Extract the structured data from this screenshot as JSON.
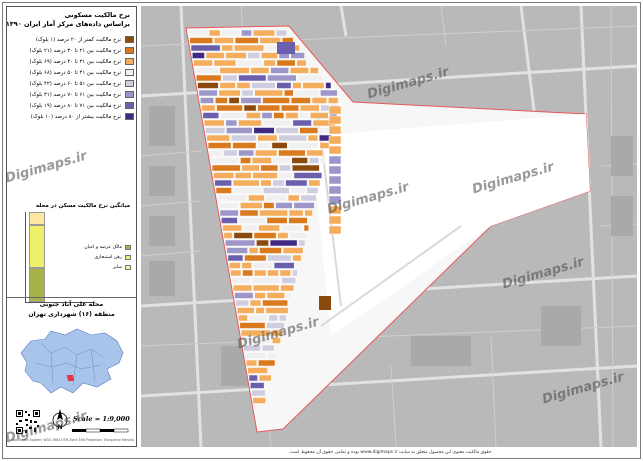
{
  "legend": {
    "title_line1": "نرخ مالکیت مسکونی",
    "title_line2": "براساس داده‌های مرکز آمار ایران ۱۳۹۰",
    "items": [
      {
        "label": "نرخ مالکیت کمتر از ۲۰ درصد (۱ بلوک)",
        "color": "#8a4a0e"
      },
      {
        "label": "نرخ مالکیت بین ۲۱ تا ۳۰ درصد (۲۱ بلوک)",
        "color": "#d97a1f"
      },
      {
        "label": "نرخ مالکیت بین ۳۱ تا ۴۰ درصد (۶۹ بلوک)",
        "color": "#f4ad5c"
      },
      {
        "label": "نرخ مالکیت بین ۴۱ تا ۵۰ درصد (۶۸ بلوک)",
        "color": "#f0f0f0"
      },
      {
        "label": "نرخ مالکیت بین ۵۱ تا ۶۰ درصد (۴۲ بلوک)",
        "color": "#cfcde0"
      },
      {
        "label": "نرخ مالکیت بین ۶۱ تا ۷۰ درصد (۳۱ بلوک)",
        "color": "#9d97c9"
      },
      {
        "label": "نرخ مالکیت بین ۷۱ تا ۸۰ درصد (۱۹ بلوک)",
        "color": "#6a5fad"
      },
      {
        "label": "نرخ مالکیت بیشتر از ۸۰ درصد (۱۰ بلوک)",
        "color": "#3f2a86"
      }
    ]
  },
  "chart": {
    "title": "میانگین نرخ مالکیت مسکن در محله",
    "legend": [
      {
        "label": "مالک عرصه و اعیان",
        "color": "#a8b24a"
      },
      {
        "label": "رهن استیجاری",
        "color": "#eef06a"
      },
      {
        "label": "سایر",
        "color": "#fde7a3"
      }
    ]
  },
  "chart_data": {
    "type": "bar",
    "categories": [
      ""
    ],
    "series": [
      {
        "name": "مالک عرصه و اعیان",
        "values": [
          38
        ]
      },
      {
        "name": "رهن استیجاری",
        "values": [
          48
        ]
      },
      {
        "name": "سایر",
        "values": [
          14
        ]
      }
    ],
    "stacked": true,
    "ylim": [
      0,
      100
    ],
    "xlabel": "",
    "ylabel": ""
  },
  "location": {
    "line1": "محله علی آباد جنوبی",
    "line2": "منطقه (۱۶) شهرداری تهران"
  },
  "scale_text": "Scale = 1:9,000",
  "credit_text": "Coordinate System: WGS 1984 UTM Zone 39N  Projection: Transverse Mercator",
  "watermark": "Digimaps.ir",
  "footer_text": "حقوق مالکیت معنوی این محصول متعلق به سایت www.digimaps.ir بوده و تمامی حقوق آن محفوظ است."
}
